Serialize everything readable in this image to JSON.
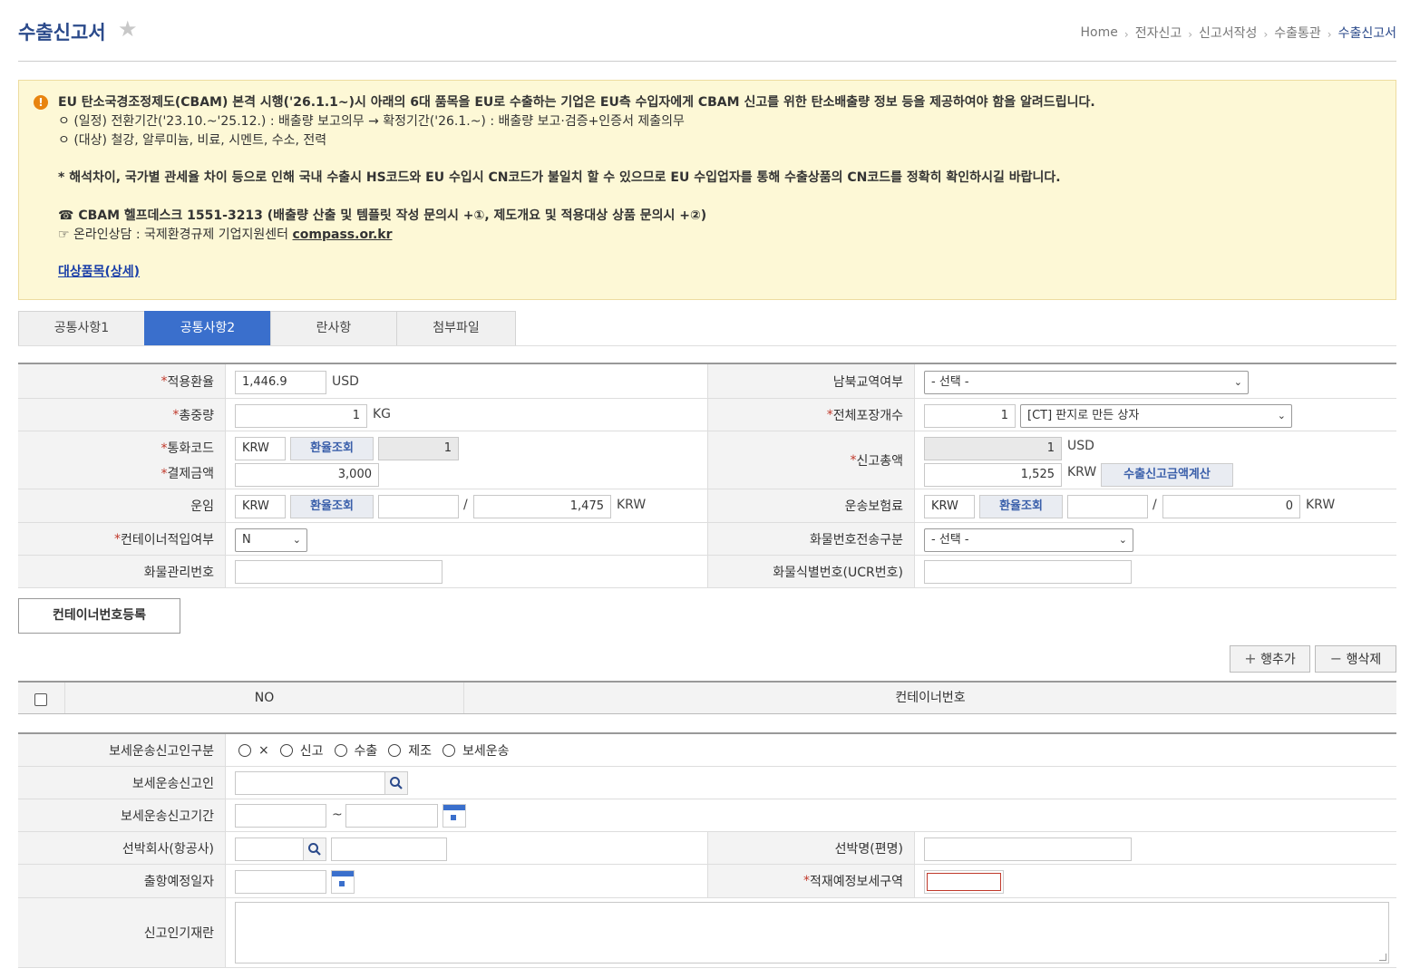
{
  "header": {
    "title": "수출신고서",
    "breadcrumb": [
      "Home",
      "전자신고",
      "신고서작성",
      "수출통관",
      "수출신고서"
    ]
  },
  "notice": {
    "line1": "EU 탄소국경조정제도(CBAM) 본격 시행('26.1.1~)시 아래의 6대 품목을 EU로 수출하는 기업은 EU측 수입자에게 CBAM 신고를 위한 탄소배출량 정보 등을 제공하여야 함을 알려드립니다.",
    "line2": "ㅇ (일정) 전환기간('23.10.~'25.12.) : 배출량 보고의무 → 확정기간('26.1.~) : 배출량 보고·검증+인증서 제출의무",
    "line3": "ㅇ (대상) 철강, 알루미늄, 비료, 시멘트, 수소, 전력",
    "line4": "* 해석차이, 국가별 관세율 차이 등으로 인해 국내 수출시 HS코드와 EU 수입시 CN코드가 불일치 할 수 있으므로 EU 수입업자를 통해 수출상품의 CN코드를 정확히 확인하시길 바랍니다.",
    "line5": "☎ CBAM 헬프데스크 1551-3213 (배출량 산출 및 템플릿 작성 문의시 +①, 제도개요 및 적용대상 상품 문의시 +②)",
    "line6_prefix": "☞ 온라인상담 : 국제환경규제 기업지원센터 ",
    "line6_link": "compass.or.kr",
    "link": "대상품목(상세)"
  },
  "tabs": [
    "공통사항1",
    "공통사항2",
    "란사항",
    "첨부파일"
  ],
  "form": {
    "exchange_rate_label": "적용환율",
    "exchange_rate_value": "1,446.9",
    "exchange_rate_unit": "USD",
    "inter_korea_label": "남북교역여부",
    "inter_korea_value": "- 선택 -",
    "total_weight_label": "총중량",
    "total_weight_value": "1",
    "total_weight_unit": "KG",
    "total_pkg_label": "전체포장개수",
    "total_pkg_value": "1",
    "total_pkg_type": "[CT] 판지로 만든 상자",
    "currency_label": "통화코드",
    "currency_value": "KRW",
    "rate_btn": "환율조회",
    "currency_rate": "1",
    "payment_label": "결제금액",
    "payment_value": "3,000",
    "declared_total_label": "신고총액",
    "declared_usd": "1",
    "usd_unit": "USD",
    "declared_krw": "1,525",
    "krw_unit": "KRW",
    "calc_btn": "수출신고금액계산",
    "freight_label": "운임",
    "freight_currency": "KRW",
    "freight_value": "1,475",
    "slash": "/",
    "insurance_label": "운송보험료",
    "insurance_currency": "KRW",
    "insurance_value": "0",
    "container_label": "컨테이너적입여부",
    "container_value": "N",
    "cargo_send_label": "화물번호전송구분",
    "cargo_send_value": "- 선택 -",
    "cargo_mgmt_label": "화물관리번호",
    "cargo_id_label": "화물식별번호(UCR번호)"
  },
  "container_register_btn": "컨테이너번호등록",
  "add_row_btn": "행추가",
  "del_row_btn": "행삭제",
  "grid": {
    "col_no": "NO",
    "col_container": "컨테이너번호"
  },
  "bond": {
    "type_label": "보세운송신고인구분",
    "type_options": [
      "×",
      "신고",
      "수출",
      "제조",
      "보세운송"
    ],
    "declarant_label": "보세운송신고인",
    "period_label": "보세운송신고기간",
    "tilde": "~",
    "ship_company_label": "선박회사(항공사)",
    "ship_name_label": "선박명(편명)",
    "departure_label": "출항예정일자",
    "loading_area_label": "적재예정보세구역",
    "remarks_label": "신고인기재란"
  }
}
